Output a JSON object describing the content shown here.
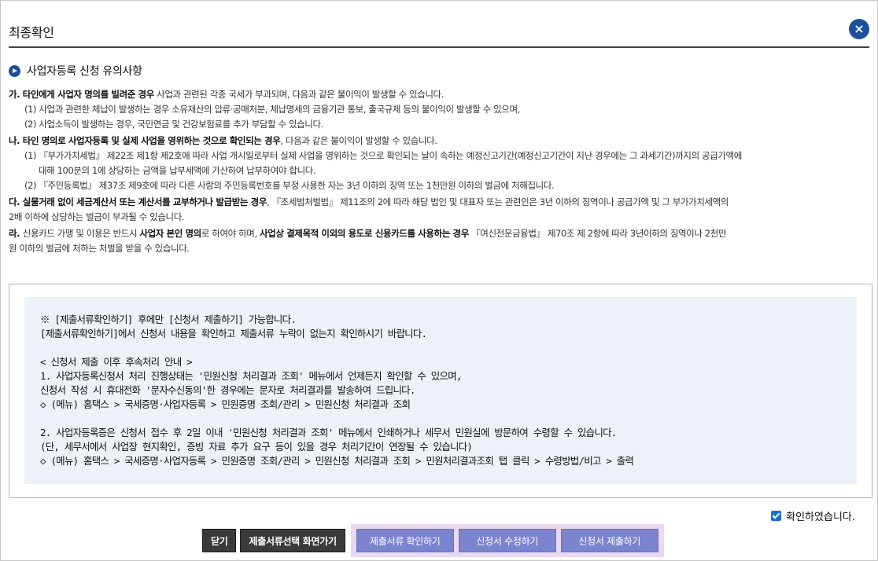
{
  "dialog": {
    "title": "최종확인",
    "close_label": "×"
  },
  "section": {
    "title": "사업자등록 신청 유의사항"
  },
  "notes": {
    "ga": {
      "prefix": "가. ",
      "bold": "타인에게 사업자 명의를 빌려준 경우",
      "rest": " 사업과 관련된 각종 국세가 부과되며, 다음과 같은 불이익이 발생할 수 있습니다.",
      "l1": "(1) 사업과 관련한 체납이 발생하는 경우 소유재산의 압류·공매처분, 체납명세의 금융기관 통보, 출국규제 등의 불이익이 발생할 수 있으며,",
      "l2": "(2) 사업소득이 발생하는 경우, 국민연금 및 건강보험료를 추가 부담할 수 있습니다."
    },
    "na": {
      "prefix": "나. ",
      "bold": "타인 명의로 사업자등록 및 실제 사업을 영위하는 것으로 확인되는 경우",
      "rest": ", 다음과 같은 불이익이 발생할 수 있습니다.",
      "l1": "(1) 『부가가치세법』 제22조 제1항 제2호에 따라 사업 개시일로부터 실제 사업을 영위하는 것으로 확인되는 날이 속하는 예정신고기간(예정신고기간이 지난 경우에는 그 과세기간)까지의 공급가액에",
      "l1b": "대해 100분의 1에 상당하는 금액을 납부세액에 가산하여 납부하여야 합니다.",
      "l2": "(2) 『주민등록법』 제37조 제9호에 따라 다른 사람의 주민등록번호를 부정 사용한 자는 3년 이하의 징역 또는 1천만원 이하의 벌금에 처해집니다."
    },
    "da": {
      "prefix": "다. ",
      "bold": "실물거래 없이 세금계산서 또는 계산서를 교부하거나 발급받는 경우",
      "rest": ", 『조세범처벌법』 제11조의 2에 따라 해당 법인 및 대표자 또는 관련인은 3년 이하의 징역이나 공급가액 및 그 부가가치세액의",
      "l1": "2배 이하에 상당하는 벌금이 부과될 수 있습니다."
    },
    "ra": {
      "prefix": "라. ",
      "t1": "신용카드 가맹 및 이용은 반드시 ",
      "b1": "사업자 본인 명의",
      "t2": "로 하여야 하며, ",
      "b2": "사업상 결제목적 이외의 용도로 신용카드를 사용하는 경우",
      "t3": " 『여신전문금융법』 제70조 제 2항에 따라 3년이하의 징역이나 2천만",
      "l1": "원 이하의 벌금에 처하는 처벌을 받을 수 있습니다."
    }
  },
  "info": {
    "lines": [
      "※  [제출서류확인하기] 후에만 [신청서 제출하기] 가능합니다.",
      "    [제출서류확인하기]에서 신청서 내용을 확인하고 제출서류 누락이 없는지 확인하시기 바랍니다.",
      "< 신청서 제출 이후 후속처리 안내 >",
      "1.  사업자등록신청서 처리 진행상태는 '민원신청 처리결과 조회' 메뉴에서 언제든지 확인할 수 있으며,",
      "    신청서 작성 시 휴대전화 '문자수신동의'한 경우에는 문자로 처리결과를 발송하여 드립니다.",
      "    ◇ (메뉴) 홈택스 > 국세증명·사업자등록 > 민원증명 조회/관리 > 민원신청 처리결과 조회",
      "2.  사업자등록증은 신청서 접수 후 2일 이내 '민원신청 처리결과 조회' 메뉴에서 인쇄하거나 세무서 민원실에 방문하여 수령할 수 있습니다.",
      "    (단, 세무서에서 사업장 현지확인, 증빙 자료 추가 요구 등이 있을 경우 처리기간이 연장될 수 있습니다)",
      "    ◇ (메뉴) 홈택스 > 국세증명·사업자등록 > 민원증명 조회/관리 > 민원신청 처리결과 조회 > 민원처리결과조회 탭 클릭 > 수령방법/비고 > 출력"
    ]
  },
  "confirm": {
    "label": "확인하였습니다.",
    "checked": true
  },
  "buttons": {
    "close": "닫기",
    "select_docs": "제출서류선택 화면가기",
    "check_docs": "제출서류 확인하기",
    "edit_app": "신청서 수정하기",
    "submit_app": "신청서 제출하기"
  },
  "colors": {
    "accent": "#1c4f9c",
    "button_purple": "#7b84cf",
    "button_dark": "#3a3a3a",
    "info_bg": "#edf2f8"
  }
}
